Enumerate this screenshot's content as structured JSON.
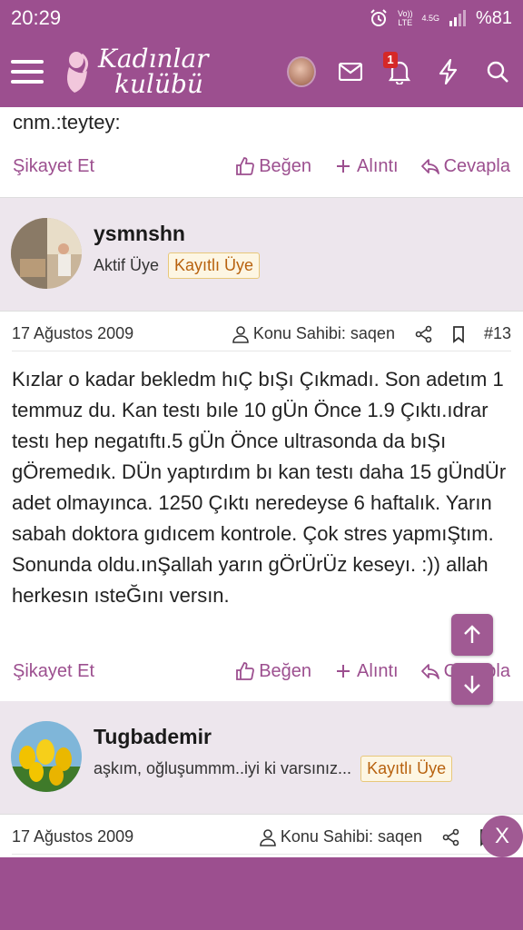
{
  "status": {
    "time": "20:29",
    "network_top": "Vo))",
    "network_bottom": "LTE",
    "net_type": "4.5G",
    "battery": "%81"
  },
  "header": {
    "logo_line1": "Kadınlar",
    "logo_line2": "kulübü",
    "notification_count": "1"
  },
  "prev_post": {
    "text": "cnm.:teytey:",
    "report": "Şikayet Et",
    "like": "Beğen",
    "quote": "Alıntı",
    "reply": "Cevapla"
  },
  "post13": {
    "username": "ysmnshn",
    "user_title": "Aktif Üye",
    "tag": "Kayıtlı Üye",
    "date": "17 Ağustos 2009",
    "starter": "Konu Sahibi: saqen",
    "number": "#13",
    "body": "Kızlar o kadar bekledm hıÇ bıŞı Çıkmadı. Son adetım 1 temmuz du. Kan testı bıle 10 gÜn Önce 1.9 Çıktı.ıdrar testı hep negatıftı.5 gÜn Önce ultrasonda da bıŞı gÖremedık. DÜn yaptırdım bı kan testı daha 15 gÜndÜr adet olmayınca. 1250 Çıktı neredeyse 6 haftalık. Yarın sabah doktora gıdıcem kontrole. Çok stres yapmıŞtım. Sonunda oldu.ınŞallah yarın gÖrÜrÜz keseyı. :)) allah herkesın ısteĞını versın.",
    "report": "Şikayet Et",
    "like": "Beğen",
    "quote": "Alıntı",
    "reply": "Cevapla"
  },
  "post14": {
    "username": "Tugbademir",
    "user_title": "aşkım, oğluşummm..iyi ki varsınız...",
    "tag": "Kayıtlı Üye",
    "date": "17 Ağustos 2009",
    "starter": "Konu Sahibi: saqen"
  },
  "close_label": "X",
  "colors": {
    "brand": "#9c4f8f",
    "band": "#ede6ed",
    "tag_text": "#b8620f"
  }
}
